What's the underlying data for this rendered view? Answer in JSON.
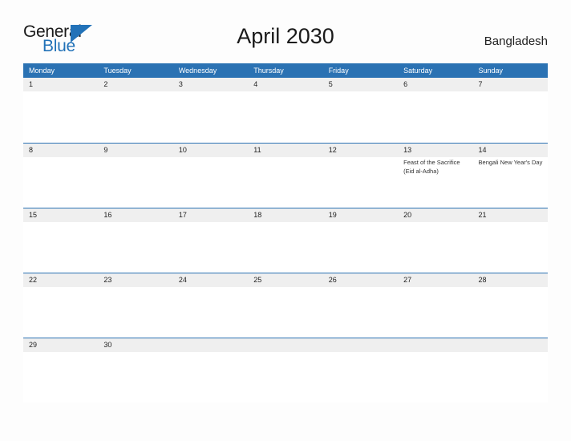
{
  "brand": {
    "name_part1": "General",
    "name_part2": "Blue",
    "triangle_icon": "triangle-right-icon",
    "accent_color": "#2272b8"
  },
  "header": {
    "title": "April 2030",
    "country": "Bangladesh",
    "header_bar_color": "#2b72b3",
    "date_band_color": "#efefef"
  },
  "calendar": {
    "month": "April",
    "year": "2030",
    "weekday_headers": [
      "Monday",
      "Tuesday",
      "Wednesday",
      "Thursday",
      "Friday",
      "Saturday",
      "Sunday"
    ],
    "weeks": [
      {
        "days": [
          {
            "date": "1",
            "holiday": ""
          },
          {
            "date": "2",
            "holiday": ""
          },
          {
            "date": "3",
            "holiday": ""
          },
          {
            "date": "4",
            "holiday": ""
          },
          {
            "date": "5",
            "holiday": ""
          },
          {
            "date": "6",
            "holiday": ""
          },
          {
            "date": "7",
            "holiday": ""
          }
        ]
      },
      {
        "days": [
          {
            "date": "8",
            "holiday": ""
          },
          {
            "date": "9",
            "holiday": ""
          },
          {
            "date": "10",
            "holiday": ""
          },
          {
            "date": "11",
            "holiday": ""
          },
          {
            "date": "12",
            "holiday": ""
          },
          {
            "date": "13",
            "holiday": "Feast of the Sacrifice (Eid al-Adha)"
          },
          {
            "date": "14",
            "holiday": "Bengali New Year's Day"
          }
        ]
      },
      {
        "days": [
          {
            "date": "15",
            "holiday": ""
          },
          {
            "date": "16",
            "holiday": ""
          },
          {
            "date": "17",
            "holiday": ""
          },
          {
            "date": "18",
            "holiday": ""
          },
          {
            "date": "19",
            "holiday": ""
          },
          {
            "date": "20",
            "holiday": ""
          },
          {
            "date": "21",
            "holiday": ""
          }
        ]
      },
      {
        "days": [
          {
            "date": "22",
            "holiday": ""
          },
          {
            "date": "23",
            "holiday": ""
          },
          {
            "date": "24",
            "holiday": ""
          },
          {
            "date": "25",
            "holiday": ""
          },
          {
            "date": "26",
            "holiday": ""
          },
          {
            "date": "27",
            "holiday": ""
          },
          {
            "date": "28",
            "holiday": ""
          }
        ]
      },
      {
        "days": [
          {
            "date": "29",
            "holiday": ""
          },
          {
            "date": "30",
            "holiday": ""
          },
          {
            "date": "",
            "holiday": ""
          },
          {
            "date": "",
            "holiday": ""
          },
          {
            "date": "",
            "holiday": ""
          },
          {
            "date": "",
            "holiday": ""
          },
          {
            "date": "",
            "holiday": ""
          }
        ]
      }
    ]
  }
}
